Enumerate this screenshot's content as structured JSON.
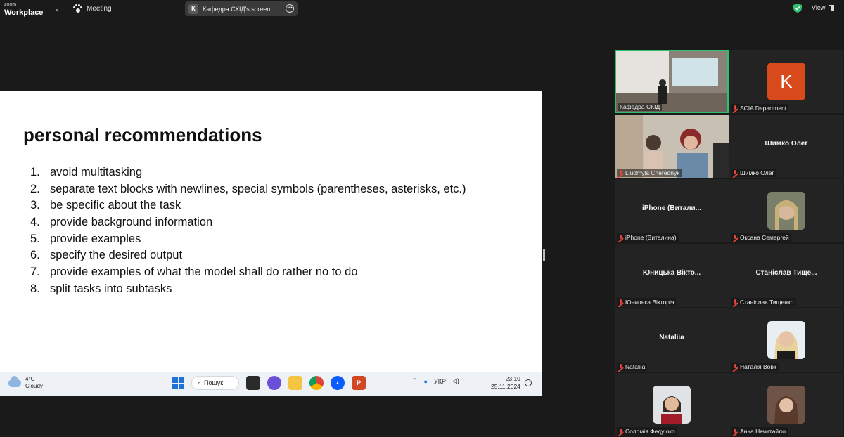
{
  "topbar": {
    "brand_small": "zoom",
    "brand_big": "Workplace",
    "meeting_label": "Meeting",
    "share_badge": "K",
    "share_label": "Кафедра СКІД's screen",
    "view_label": "View"
  },
  "slide": {
    "title": "personal recommendations",
    "items": [
      {
        "num": "1.",
        "text": "avoid multitasking"
      },
      {
        "num": "2.",
        "text": "separate text blocks with newlines, special symbols (parentheses, asterisks, etc.)"
      },
      {
        "num": "3.",
        "text": "be specific about the task"
      },
      {
        "num": "4.",
        "text": "provide background information"
      },
      {
        "num": "5.",
        "text": "provide examples"
      },
      {
        "num": "6.",
        "text": "specify the desired output"
      },
      {
        "num": "7.",
        "text": "provide examples of what the model shall do rather no to do"
      },
      {
        "num": "8.",
        "text": "split tasks into subtasks"
      }
    ]
  },
  "taskbar": {
    "temp": "4°C",
    "weather": "Cloudy",
    "search_label": "Пошук",
    "lang": "УКР",
    "time": "23:10",
    "date": "25.11.2024"
  },
  "participants": [
    {
      "label": "Кафедра СКІД",
      "display": "",
      "kind": "video-room"
    },
    {
      "label": "SCIA Department",
      "display": "K",
      "kind": "initial"
    },
    {
      "label": "Liudmyla Cherednyk",
      "display": "",
      "kind": "video-people"
    },
    {
      "label": "Шимко Олег",
      "display": "Шимко Олег",
      "kind": "name"
    },
    {
      "label": "iPhone (Виталина)",
      "display": "iPhone (Витали...",
      "kind": "name"
    },
    {
      "label": "Оксана Семергей",
      "display": "",
      "kind": "photo"
    },
    {
      "label": "Юницька Вікторія",
      "display": "Юницька Вікто...",
      "kind": "name"
    },
    {
      "label": "Станіслав Тищенко",
      "display": "Станіслав Тище...",
      "kind": "name"
    },
    {
      "label": "Nataliia",
      "display": "Nataliia",
      "kind": "name"
    },
    {
      "label": "Наталія Вовк",
      "display": "",
      "kind": "photo"
    },
    {
      "label": "Соломія Федушко",
      "display": "",
      "kind": "photo"
    },
    {
      "label": "Анна Нечитайло",
      "display": "",
      "kind": "photo"
    }
  ],
  "colors": {
    "active_border": "#2fbf71",
    "mic_muted": "#e0443a",
    "avatar_k": "#d84a1c"
  }
}
